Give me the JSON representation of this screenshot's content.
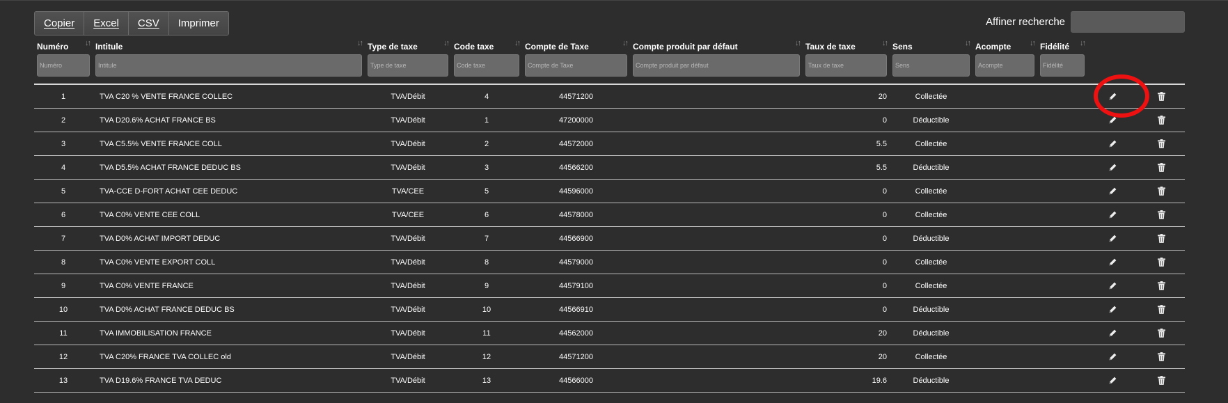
{
  "toolbar": {
    "buttons": [
      {
        "label": "Copier"
      },
      {
        "label": "Excel"
      },
      {
        "label": "CSV"
      },
      {
        "label": "Imprimer"
      }
    ]
  },
  "search": {
    "label": "Affiner recherche",
    "value": "",
    "placeholder": ""
  },
  "table": {
    "columns": [
      {
        "label": "Numéro",
        "placeholder": "Numéro"
      },
      {
        "label": "Intitule",
        "placeholder": "Intitule"
      },
      {
        "label": "Type de taxe",
        "placeholder": "Type de taxe"
      },
      {
        "label": "Code taxe",
        "placeholder": "Code taxe"
      },
      {
        "label": "Compte de Taxe",
        "placeholder": "Compte de Taxe"
      },
      {
        "label": "Compte produit par défaut",
        "placeholder": "Compte produit par défaut"
      },
      {
        "label": "Taux de taxe",
        "placeholder": "Taux de taxe"
      },
      {
        "label": "Sens",
        "placeholder": "Sens"
      },
      {
        "label": "Acompte",
        "placeholder": "Acompte"
      },
      {
        "label": "Fidélité",
        "placeholder": "Fidélité"
      }
    ],
    "rows": [
      {
        "num": "1",
        "intitule": "TVA C20 % VENTE FRANCE COLLEC",
        "type": "TVA/Débit",
        "code": "4",
        "compte": "44571200",
        "produit": "",
        "taux": "20",
        "sens": "Collectée",
        "acompte": "",
        "fidelite": ""
      },
      {
        "num": "2",
        "intitule": "TVA D20.6% ACHAT FRANCE BS",
        "type": "TVA/Débit",
        "code": "1",
        "compte": "47200000",
        "produit": "",
        "taux": "0",
        "sens": "Déductible",
        "acompte": "",
        "fidelite": ""
      },
      {
        "num": "3",
        "intitule": "TVA C5.5% VENTE FRANCE COLL",
        "type": "TVA/Débit",
        "code": "2",
        "compte": "44572000",
        "produit": "",
        "taux": "5.5",
        "sens": "Collectée",
        "acompte": "",
        "fidelite": ""
      },
      {
        "num": "4",
        "intitule": "TVA D5.5% ACHAT FRANCE DEDUC BS",
        "type": "TVA/Débit",
        "code": "3",
        "compte": "44566200",
        "produit": "",
        "taux": "5.5",
        "sens": "Déductible",
        "acompte": "",
        "fidelite": ""
      },
      {
        "num": "5",
        "intitule": "TVA-CCE D-FORT ACHAT CEE DEDUC",
        "type": "TVA/CEE",
        "code": "5",
        "compte": "44596000",
        "produit": "",
        "taux": "0",
        "sens": "Collectée",
        "acompte": "",
        "fidelite": ""
      },
      {
        "num": "6",
        "intitule": "TVA C0% VENTE CEE COLL",
        "type": "TVA/CEE",
        "code": "6",
        "compte": "44578000",
        "produit": "",
        "taux": "0",
        "sens": "Collectée",
        "acompte": "",
        "fidelite": ""
      },
      {
        "num": "7",
        "intitule": "TVA D0% ACHAT IMPORT DEDUC",
        "type": "TVA/Débit",
        "code": "7",
        "compte": "44566900",
        "produit": "",
        "taux": "0",
        "sens": "Déductible",
        "acompte": "",
        "fidelite": ""
      },
      {
        "num": "8",
        "intitule": "TVA C0% VENTE EXPORT COLL",
        "type": "TVA/Débit",
        "code": "8",
        "compte": "44579000",
        "produit": "",
        "taux": "0",
        "sens": "Collectée",
        "acompte": "",
        "fidelite": ""
      },
      {
        "num": "9",
        "intitule": "TVA C0% VENTE FRANCE",
        "type": "TVA/Débit",
        "code": "9",
        "compte": "44579100",
        "produit": "",
        "taux": "0",
        "sens": "Collectée",
        "acompte": "",
        "fidelite": ""
      },
      {
        "num": "10",
        "intitule": "TVA D0% ACHAT FRANCE DEDUC BS",
        "type": "TVA/Débit",
        "code": "10",
        "compte": "44566910",
        "produit": "",
        "taux": "0",
        "sens": "Déductible",
        "acompte": "",
        "fidelite": ""
      },
      {
        "num": "11",
        "intitule": "TVA IMMOBILISATION FRANCE",
        "type": "TVA/Débit",
        "code": "11",
        "compte": "44562000",
        "produit": "",
        "taux": "20",
        "sens": "Déductible",
        "acompte": "",
        "fidelite": ""
      },
      {
        "num": "12",
        "intitule": "TVA C20% FRANCE TVA COLLEC old",
        "type": "TVA/Débit",
        "code": "12",
        "compte": "44571200",
        "produit": "",
        "taux": "20",
        "sens": "Collectée",
        "acompte": "",
        "fidelite": ""
      },
      {
        "num": "13",
        "intitule": "TVA D19.6% FRANCE TVA DEDUC",
        "type": "TVA/Débit",
        "code": "13",
        "compte": "44566000",
        "produit": "",
        "taux": "19.6",
        "sens": "Déductible",
        "acompte": "",
        "fidelite": ""
      }
    ]
  },
  "icons": {
    "edit": "pencil-icon",
    "delete": "trash-icon",
    "sort": "sort-icon"
  },
  "colors": {
    "background": "#2d2d2d",
    "highlight": "#ee1111",
    "filter": "#6a6a6a"
  }
}
